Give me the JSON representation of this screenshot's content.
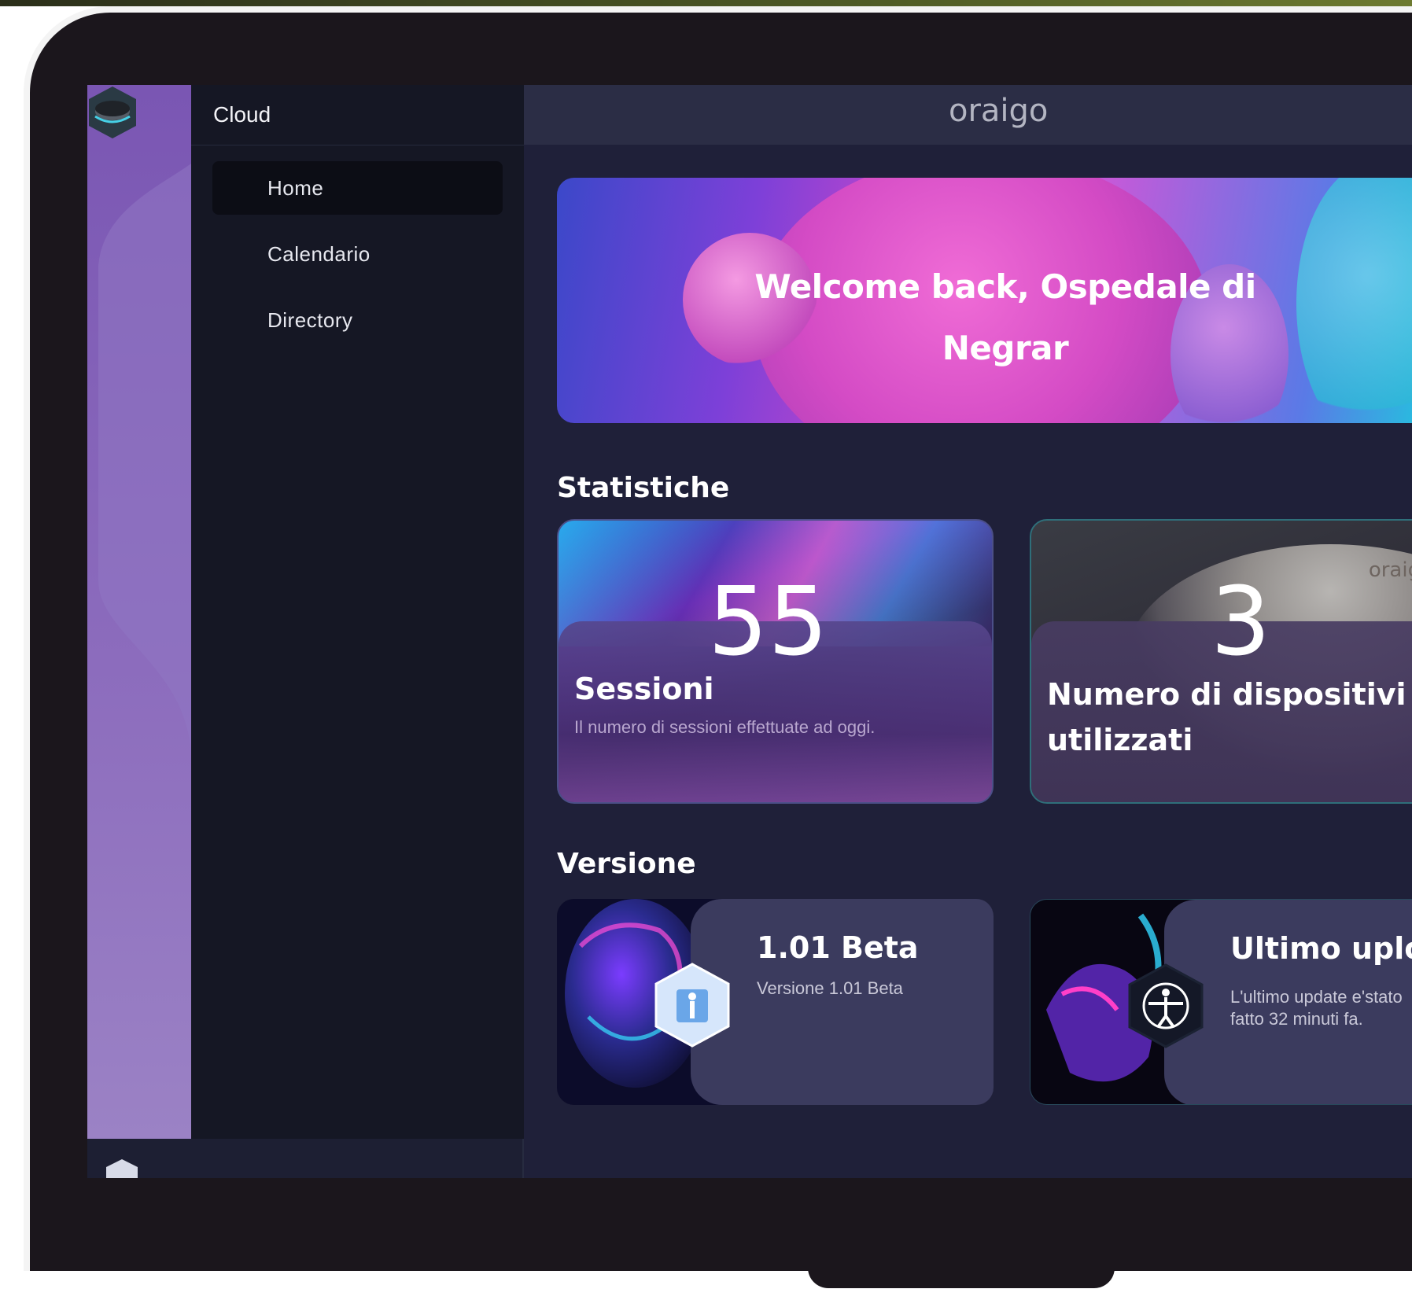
{
  "sidebar": {
    "title": "Cloud",
    "items": [
      {
        "label": "Home"
      },
      {
        "label": "Calendario"
      },
      {
        "label": "Directory"
      }
    ]
  },
  "header": {
    "brand": "oraigo"
  },
  "hero": {
    "line1": "Welcome back, Ospedale di",
    "line2": "Negrar"
  },
  "stats": {
    "title": "Statistiche",
    "sessions": {
      "value": "55",
      "label": "Sessioni",
      "description": "Il numero di sessioni effettuate ad oggi."
    },
    "devices": {
      "value": "3",
      "label_line1": "Numero di dispositivi",
      "label_line2": "utilizzati",
      "brand": "oraigo"
    }
  },
  "version": {
    "title": "Versione",
    "current": {
      "title": "1.01 Beta",
      "description": "Versione 1.01 Beta"
    },
    "last_upload": {
      "title": "Ultimo uplo",
      "description_line1": "L'ultimo update e'stato",
      "description_line2": "fatto 32 minuti fa."
    }
  },
  "icons": {
    "app_logo": "cube-logo-icon",
    "version_badge": "body-scan-icon",
    "upload_badge": "vitruvian-man-icon"
  },
  "colors": {
    "accent_purple": "#7a56b3",
    "brand_green": "#9ccf2e",
    "background": "#1f2039"
  }
}
